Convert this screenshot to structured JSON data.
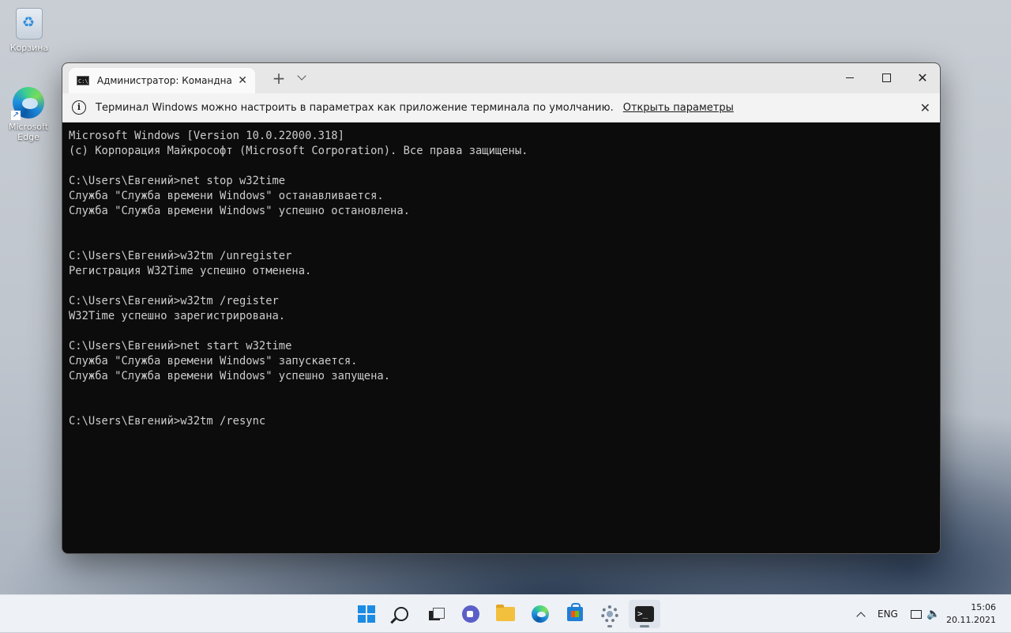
{
  "desktop": {
    "icons": [
      {
        "label": "Корзина",
        "icon": "recycle-bin-icon"
      },
      {
        "label_line1": "Microsoft",
        "label_line2": "Edge",
        "icon": "edge-icon"
      }
    ]
  },
  "window": {
    "tab_title": "Администратор: Командная ст",
    "new_tab_symbol": "+",
    "close_symbol": "✕",
    "infobar": {
      "message": "Терминал Windows можно настроить в параметрах как приложение терминала по умолчанию.",
      "link": "Открыть параметры",
      "info_symbol": "i",
      "close_symbol": "✕"
    },
    "console_lines": [
      "Microsoft Windows [Version 10.0.22000.318]",
      "(c) Корпорация Майкрософт (Microsoft Corporation). Все права защищены.",
      "",
      "C:\\Users\\Евгений>net stop w32time",
      "Служба \"Служба времени Windows\" останавливается.",
      "Служба \"Служба времени Windows\" успешно остановлена.",
      "",
      "",
      "C:\\Users\\Евгений>w32tm /unregister",
      "Регистрация W32Time успешно отменена.",
      "",
      "C:\\Users\\Евгений>w32tm /register",
      "W32Time успешно зарегистрирована.",
      "",
      "C:\\Users\\Евгений>net start w32time",
      "Служба \"Служба времени Windows\" запускается.",
      "Служба \"Служба времени Windows\" успешно запущена.",
      "",
      "",
      "C:\\Users\\Евгений>w32tm /resync"
    ]
  },
  "taskbar": {
    "apps": [
      "start-icon",
      "search-icon",
      "task-view-icon",
      "teams-chat-icon",
      "file-explorer-icon",
      "edge-icon",
      "store-icon",
      "settings-gear-icon",
      "terminal-icon"
    ],
    "terminal_glyph": ">_",
    "language": "ENG",
    "volume_symbol": "🔈",
    "time": "15:06",
    "date": "20.11.2021"
  }
}
